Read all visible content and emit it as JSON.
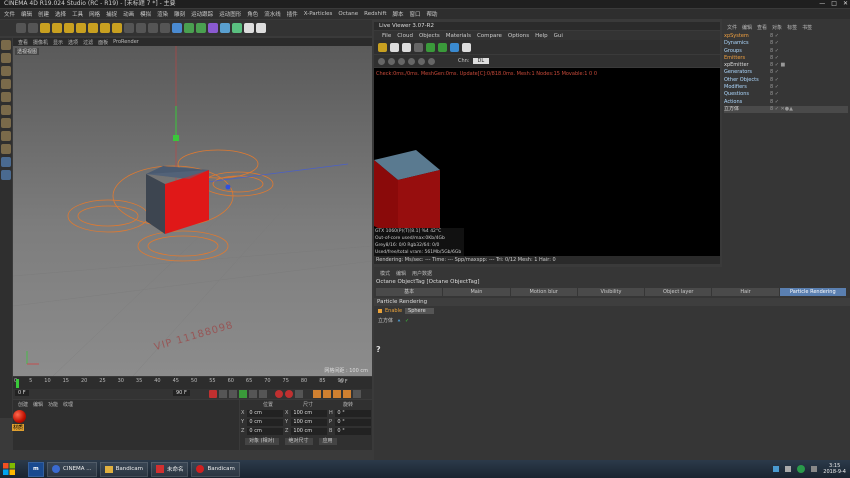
{
  "window": {
    "title": "CINEMA 4D R19.024 Studio (RC - R19) - [未标题 7 *] - 主要",
    "controls": [
      "—",
      "□",
      "✕"
    ]
  },
  "menubar": [
    "文件",
    "编辑",
    "创建",
    "选择",
    "工具",
    "网格",
    "捕捉",
    "动画",
    "模拟",
    "渲染",
    "雕刻",
    "运动跟踪",
    "运动图形",
    "角色",
    "流水线",
    "插件",
    "X-Particles",
    "Octane",
    "Redshift",
    "脚本",
    "窗口",
    "帮助"
  ],
  "viewport": {
    "menu": [
      "查看",
      "摄像机",
      "显示",
      "选项",
      "过滤",
      "面板",
      "ProRender"
    ],
    "label": "透视视图",
    "footer": "网格间距 : 100 cm",
    "watermark": "VIP 11188098"
  },
  "timeline": {
    "ticks": [
      "0",
      "5",
      "10",
      "15",
      "20",
      "25",
      "30",
      "35",
      "40",
      "45",
      "50",
      "55",
      "60",
      "65",
      "70",
      "75",
      "80",
      "85",
      "90"
    ],
    "start": "0 F",
    "end": "90 F",
    "current": "0 F"
  },
  "material_panel": {
    "menu": [
      "创建",
      "编辑",
      "功能",
      "纹理"
    ],
    "material_label": "材质"
  },
  "coordinates": {
    "headers": [
      "位置",
      "尺寸",
      "旋转"
    ],
    "rows": [
      {
        "axis": "X",
        "pos": "0 cm",
        "size": "100 cm",
        "rot_axis": "H",
        "rot": "0 °"
      },
      {
        "axis": "Y",
        "pos": "0 cm",
        "size": "100 cm",
        "rot_axis": "P",
        "rot": "0 °"
      },
      {
        "axis": "Z",
        "pos": "0 cm",
        "size": "100 cm",
        "rot_axis": "B",
        "rot": "0 °"
      }
    ],
    "buttons": [
      "对象 (相对)",
      "绝对尺寸",
      "应用"
    ]
  },
  "live_viewer": {
    "title": "Live Viewer 3.07-R2",
    "menu": [
      "File",
      "Cloud",
      "Objects",
      "Materials",
      "Compare",
      "Options",
      "Help",
      "Gui"
    ],
    "channel_label": "Chn:",
    "channel_value": "DL",
    "status": "Check:0ms./0ms. MeshGen:0ms. Update[C]:0/818.0ms. Mesh:1 Nodes:15 Movable:1  0 0",
    "gpu": [
      "GTX 1060(P)(T)[8.1]      %4     42°C",
      "Out-of-core used/max:0Kb/4Gb",
      "Grey8/16: 0/0         Rgb32/64: 0/0",
      "Used/free/total vram: 561Mb/5Gb/6Gb"
    ],
    "footer": "Rendering:    Ms/sec: ---   Time: ---      Spp/maxspp: ---   Tri: 0/12   Mesh: 1    Hair: 0"
  },
  "object_manager": {
    "menu": [
      "文件",
      "编辑",
      "查看",
      "对象",
      "标签",
      "书签"
    ],
    "items": [
      {
        "name": "xpSystem",
        "class": "orange",
        "flag": "8 ✓"
      },
      {
        "name": "Dynamics",
        "class": "",
        "flag": "8 ✓"
      },
      {
        "name": "Groups",
        "class": "",
        "flag": "8 ✓"
      },
      {
        "name": "Emitters",
        "class": "orange",
        "flag": "8 ✓"
      },
      {
        "name": "xpEmitter",
        "class": "white",
        "flag": "8 ✓ ■"
      },
      {
        "name": "Generators",
        "class": "",
        "flag": "8 ✓"
      },
      {
        "name": "Other Objects",
        "class": "",
        "flag": "8 ✓"
      },
      {
        "name": "Modifiers",
        "class": "",
        "flag": "8 ✓"
      },
      {
        "name": "Questions",
        "class": "",
        "flag": "8 ✓"
      },
      {
        "name": "Actions",
        "class": "",
        "flag": "8 ✓"
      },
      {
        "name": "立方体",
        "class": "white sel",
        "flag": "8 ✓ ✕●▲"
      }
    ]
  },
  "attribute_manager": {
    "menu": [
      "模式",
      "编辑",
      "用户数据"
    ],
    "object_line": "Octane ObjectTag [Octane ObjectTag]",
    "tabs": [
      "基本",
      "Main",
      "Motion blur",
      "Visibility",
      "Object layer",
      "Hair",
      "Particle Rendering"
    ],
    "active_tab": "Particle Rendering",
    "section": "Particle Rendering",
    "enable_label": "Enable",
    "enable_value": "Sphere",
    "link_label": "立方体",
    "question": "?"
  },
  "taskbar": {
    "items": [
      "CINEMA ...",
      "Bandicam",
      "未命名",
      "Bandicam"
    ],
    "time": "3:15",
    "date": "2018-9-4"
  }
}
